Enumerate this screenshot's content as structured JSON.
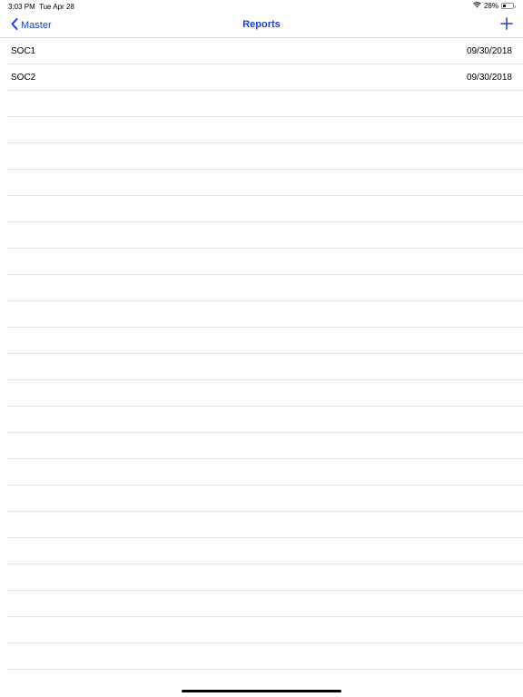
{
  "status_bar": {
    "time": "3:03 PM",
    "date": "Tue Apr 28",
    "battery_text": "28%",
    "battery_level": 0.28
  },
  "nav": {
    "back_label": "Master",
    "title": "Reports",
    "add_icon": "plus-icon",
    "accent_color": "#1d3fd9"
  },
  "reports": [
    {
      "name": "SOC1",
      "date": "09/30/2018"
    },
    {
      "name": "SOC2",
      "date": "09/30/2018"
    }
  ]
}
